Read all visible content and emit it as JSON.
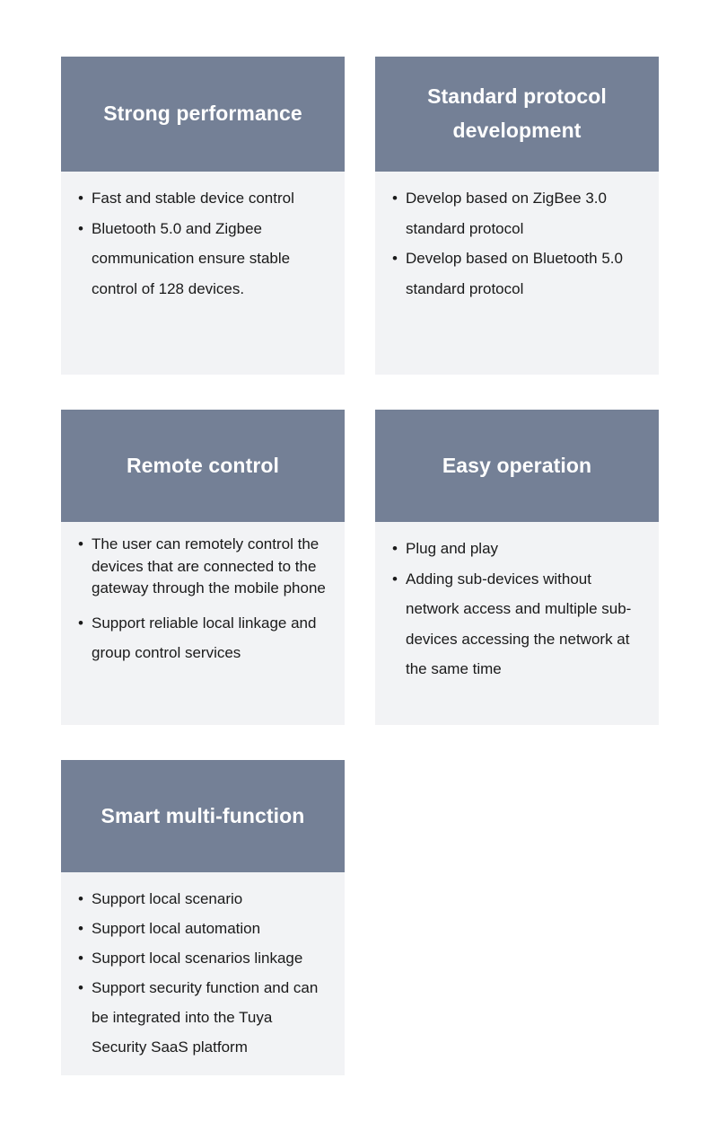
{
  "theme": {
    "page_background": "#ffffff",
    "header_background": "#748096",
    "body_background": "#f2f3f5",
    "title_color": "#ffffff",
    "text_color": "#1a1a1a",
    "bullet_glyph": "•"
  },
  "cards": [
    {
      "id": "strong-performance",
      "title": "Strong performance",
      "bullets": [
        "Fast and stable device control",
        "Bluetooth 5.0 and Zigbee communication ensure stable control of 128 devices."
      ]
    },
    {
      "id": "standard-protocol",
      "title": "Standard protocol development",
      "bullets": [
        "Develop based on ZigBee 3.0 standard protocol",
        "Develop based on Bluetooth 5.0 standard protocol"
      ]
    },
    {
      "id": "remote-control",
      "title": "Remote control",
      "bullets": [
        "The user can remotely control the devices that are connected to the gateway through the mobile phone",
        "Support reliable local linkage and group control services"
      ]
    },
    {
      "id": "easy-operation",
      "title": "Easy operation",
      "bullets": [
        "Plug and play",
        "Adding sub-devices without network access and multiple sub-devices accessing the network at the same time"
      ]
    },
    {
      "id": "smart-multifunction",
      "title": "Smart multi-function",
      "bullets": [
        "Support local scenario",
        "Support local automation",
        "Support local scenarios linkage",
        "Support security function and can be integrated into the Tuya Security SaaS platform"
      ]
    }
  ]
}
